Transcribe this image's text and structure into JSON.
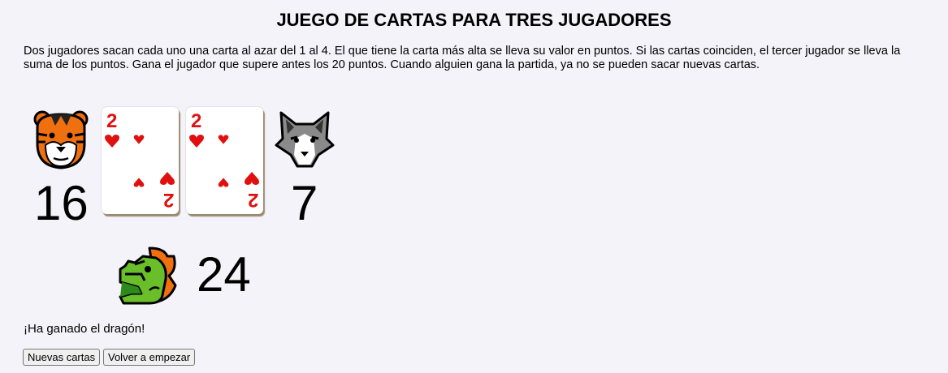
{
  "title": "JUEGO DE CARTAS PARA TRES JUGADORES",
  "description": "Dos jugadores sacan cada uno una carta al azar del 1 al 4. El que tiene la carta más alta se lleva su valor en puntos. Si las cartas coinciden, el tercer jugador se lleva la suma de los puntos. Gana el jugador que supere antes los 20 puntos. Cuando alguien gana la partida, ya no se pueden sacar nuevas cartas.",
  "players": {
    "tiger": {
      "icon": "tiger-icon",
      "score": "16"
    },
    "wolf": {
      "icon": "wolf-icon",
      "score": "7"
    },
    "dragon": {
      "icon": "dragon-icon",
      "score": "24"
    }
  },
  "cards": [
    {
      "rank": "2",
      "suit": "hearts"
    },
    {
      "rank": "2",
      "suit": "hearts"
    }
  ],
  "status": "¡Ha ganado el dragón!",
  "buttons": {
    "new_cards": "Nuevas cartas",
    "restart": "Volver a empezar"
  },
  "colors": {
    "background": "#f3f3f9",
    "card_red": "#e01010"
  }
}
